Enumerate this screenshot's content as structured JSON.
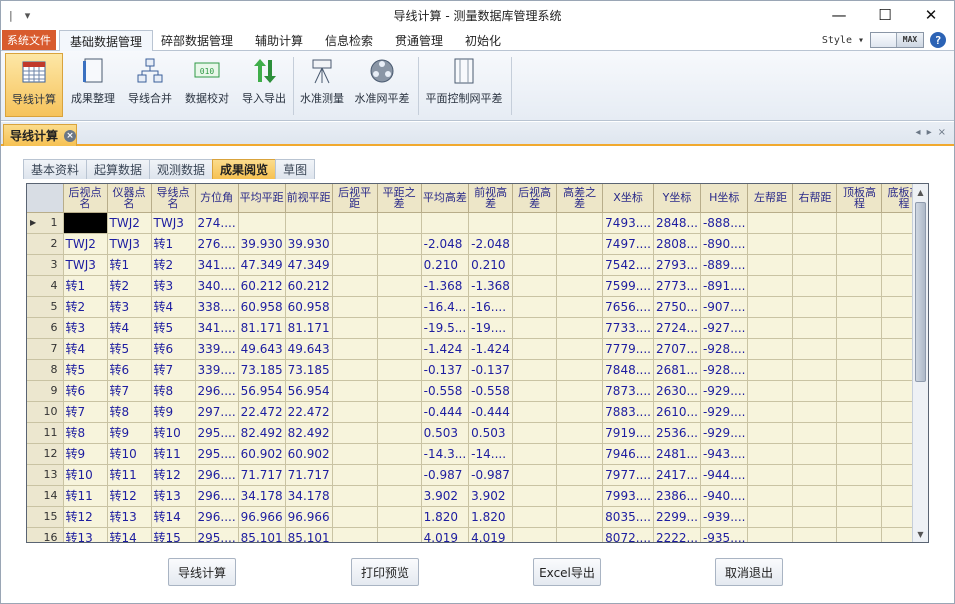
{
  "window": {
    "title": "导线计算 - 测量数据库管理系统",
    "minimize": "—",
    "maximize": "☐",
    "close": "✕"
  },
  "qat": {
    "sep": "|",
    "menu": "▾"
  },
  "ribbon_tabs": {
    "file": "系统文件",
    "tabs": [
      "基础数据管理",
      "碎部数据管理",
      "辅助计算",
      "信息检索",
      "贯通管理",
      "初始化"
    ],
    "active_index": 0,
    "style_label": "Style",
    "style_caret": "▾",
    "style_value": "MAX",
    "help": "?"
  },
  "ribbon_buttons": [
    {
      "label": "导线计算",
      "icon": "calendar-grid-icon"
    },
    {
      "label": "成果整理",
      "icon": "document-icon"
    },
    {
      "label": "导线合并",
      "icon": "network-merge-icon"
    },
    {
      "label": "数据校对",
      "icon": "binary-check-icon"
    },
    {
      "label": "导入导出",
      "icon": "up-down-arrows-icon"
    },
    {
      "label": "水准测量",
      "icon": "level-instrument-icon"
    },
    {
      "label": "水准网平差",
      "icon": "film-reel-icon"
    },
    {
      "label": "平面控制网平差",
      "icon": "sheet-icon"
    }
  ],
  "doc_tab": {
    "label": "导线计算",
    "close": "×",
    "ctrl_left": "◂",
    "ctrl_right": "▸",
    "ctrl_close": "×"
  },
  "panel_tabs": {
    "tabs": [
      "基本资料",
      "起算数据",
      "观测数据",
      "成果阅览",
      "草图"
    ],
    "active_index": 3
  },
  "grid": {
    "columns": [
      "后视点名",
      "仪器点名",
      "导线点名",
      "方位角",
      "平均平距",
      "前视平距",
      "后视平距",
      "平距之差",
      "平均高差",
      "前视高差",
      "后视高差",
      "高差之差",
      "X坐标",
      "Y坐标",
      "H坐标",
      "左帮距",
      "右帮距",
      "顶板高程",
      "底板高程"
    ],
    "rows": [
      {
        "n": "1",
        "c": [
          "",
          "TWJ2",
          "TWJ3",
          "274....",
          "",
          "",
          "",
          "",
          "",
          "",
          "",
          "",
          "7493....",
          "2848...",
          "-888....",
          "",
          "",
          "",
          ""
        ]
      },
      {
        "n": "2",
        "c": [
          "TWJ2",
          "TWJ3",
          "转1",
          "276....",
          "39.930",
          "39.930",
          "",
          "",
          "-2.048",
          "-2.048",
          "",
          "",
          "7497....",
          "2808...",
          "-890....",
          "",
          "",
          "",
          ""
        ]
      },
      {
        "n": "3",
        "c": [
          "TWJ3",
          "转1",
          "转2",
          "341....",
          "47.349",
          "47.349",
          "",
          "",
          "0.210",
          "0.210",
          "",
          "",
          "7542....",
          "2793...",
          "-889....",
          "",
          "",
          "",
          ""
        ]
      },
      {
        "n": "4",
        "c": [
          "转1",
          "转2",
          "转3",
          "340....",
          "60.212",
          "60.212",
          "",
          "",
          "-1.368",
          "-1.368",
          "",
          "",
          "7599....",
          "2773...",
          "-891....",
          "",
          "",
          "",
          ""
        ]
      },
      {
        "n": "5",
        "c": [
          "转2",
          "转3",
          "转4",
          "338....",
          "60.958",
          "60.958",
          "",
          "",
          "-16.4...",
          "-16....",
          "",
          "",
          "7656....",
          "2750...",
          "-907....",
          "",
          "",
          "",
          ""
        ]
      },
      {
        "n": "6",
        "c": [
          "转3",
          "转4",
          "转5",
          "341....",
          "81.171",
          "81.171",
          "",
          "",
          "-19.5...",
          "-19....",
          "",
          "",
          "7733....",
          "2724...",
          "-927....",
          "",
          "",
          "",
          ""
        ]
      },
      {
        "n": "7",
        "c": [
          "转4",
          "转5",
          "转6",
          "339....",
          "49.643",
          "49.643",
          "",
          "",
          "-1.424",
          "-1.424",
          "",
          "",
          "7779....",
          "2707...",
          "-928....",
          "",
          "",
          "",
          ""
        ]
      },
      {
        "n": "8",
        "c": [
          "转5",
          "转6",
          "转7",
          "339....",
          "73.185",
          "73.185",
          "",
          "",
          "-0.137",
          "-0.137",
          "",
          "",
          "7848....",
          "2681...",
          "-928....",
          "",
          "",
          "",
          ""
        ]
      },
      {
        "n": "9",
        "c": [
          "转6",
          "转7",
          "转8",
          "296....",
          "56.954",
          "56.954",
          "",
          "",
          "-0.558",
          "-0.558",
          "",
          "",
          "7873....",
          "2630...",
          "-929....",
          "",
          "",
          "",
          ""
        ]
      },
      {
        "n": "10",
        "c": [
          "转7",
          "转8",
          "转9",
          "297....",
          "22.472",
          "22.472",
          "",
          "",
          "-0.444",
          "-0.444",
          "",
          "",
          "7883....",
          "2610...",
          "-929....",
          "",
          "",
          "",
          ""
        ]
      },
      {
        "n": "11",
        "c": [
          "转8",
          "转9",
          "转10",
          "295....",
          "82.492",
          "82.492",
          "",
          "",
          "0.503",
          "0.503",
          "",
          "",
          "7919....",
          "2536...",
          "-929....",
          "",
          "",
          "",
          ""
        ]
      },
      {
        "n": "12",
        "c": [
          "转9",
          "转10",
          "转11",
          "295....",
          "60.902",
          "60.902",
          "",
          "",
          "-14.3...",
          "-14....",
          "",
          "",
          "7946....",
          "2481...",
          "-943....",
          "",
          "",
          "",
          ""
        ]
      },
      {
        "n": "13",
        "c": [
          "转10",
          "转11",
          "转12",
          "296....",
          "71.717",
          "71.717",
          "",
          "",
          "-0.987",
          "-0.987",
          "",
          "",
          "7977....",
          "2417...",
          "-944....",
          "",
          "",
          "",
          ""
        ]
      },
      {
        "n": "14",
        "c": [
          "转11",
          "转12",
          "转13",
          "296....",
          "34.178",
          "34.178",
          "",
          "",
          "3.902",
          "3.902",
          "",
          "",
          "7993....",
          "2386...",
          "-940....",
          "",
          "",
          "",
          ""
        ]
      },
      {
        "n": "15",
        "c": [
          "转12",
          "转13",
          "转14",
          "296....",
          "96.966",
          "96.966",
          "",
          "",
          "1.820",
          "1.820",
          "",
          "",
          "8035....",
          "2299...",
          "-939....",
          "",
          "",
          "",
          ""
        ]
      },
      {
        "n": "16",
        "c": [
          "转13",
          "转14",
          "转15",
          "295....",
          "85.101",
          "85.101",
          "",
          "",
          "4.019",
          "4.019",
          "",
          "",
          "8072....",
          "2222...",
          "-935....",
          "",
          "",
          "",
          ""
        ]
      }
    ],
    "row_pointer": "▶",
    "scroll_up": "▲",
    "scroll_down": "▼"
  },
  "actions": [
    "导线计算",
    "打印预览",
    "Excel导出",
    "取消退出"
  ]
}
